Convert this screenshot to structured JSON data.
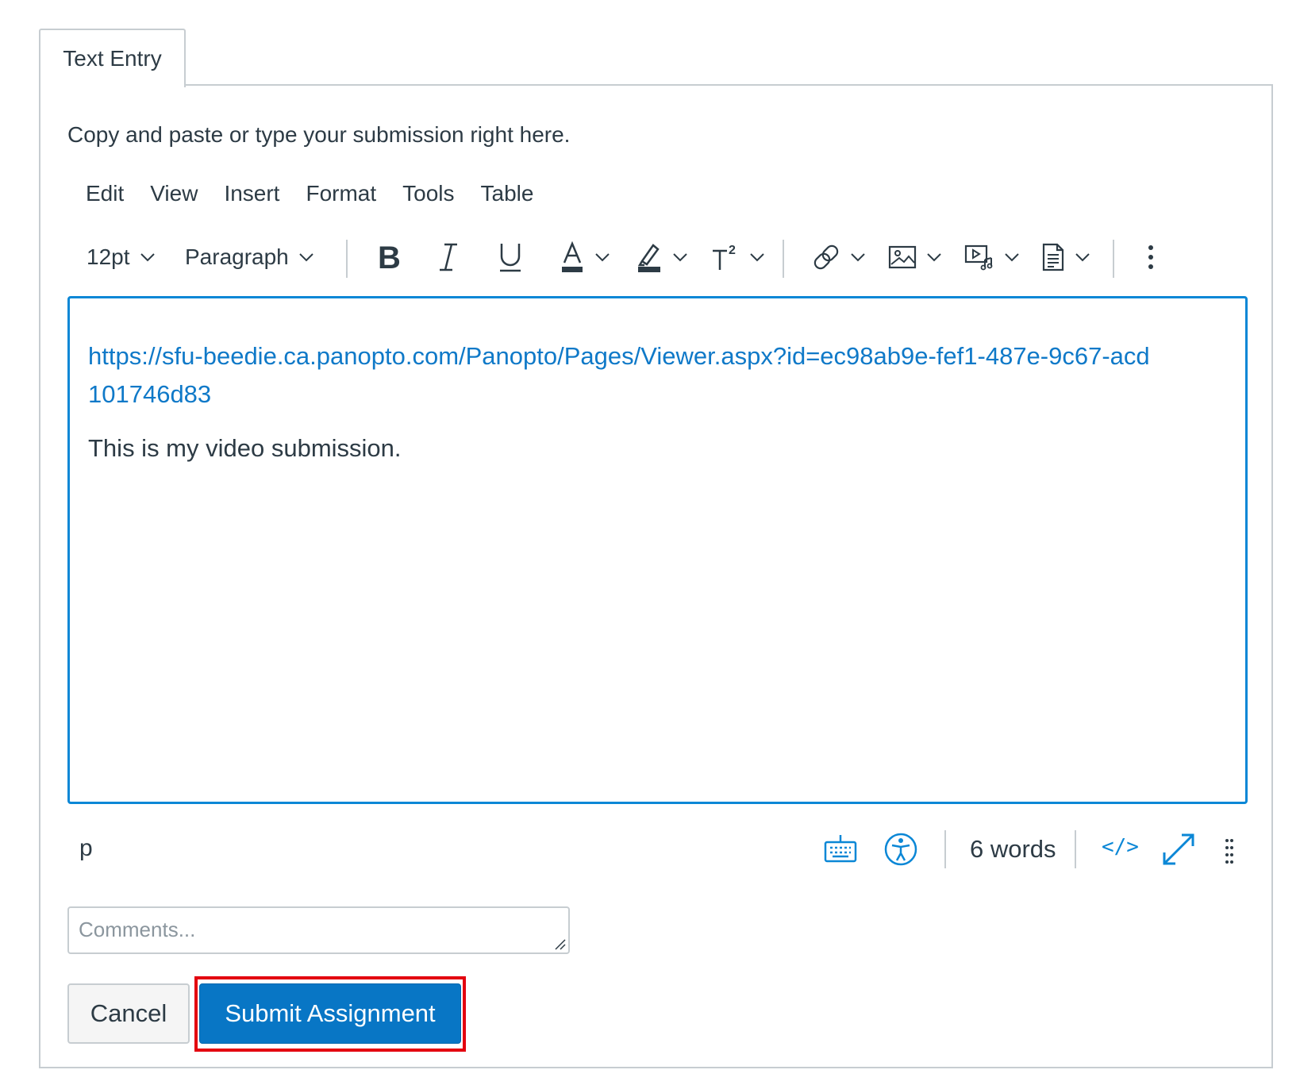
{
  "tab": {
    "label": "Text Entry"
  },
  "instructions": "Copy and paste or type your submission right here.",
  "menubar": {
    "items": [
      "Edit",
      "View",
      "Insert",
      "Format",
      "Tools",
      "Table"
    ]
  },
  "toolbar": {
    "font_size": "12pt",
    "block_format": "Paragraph",
    "icons": [
      "bold-icon",
      "italic-icon",
      "underline-icon",
      "text-color-icon",
      "highlight-color-icon",
      "superscript-icon",
      "link-icon",
      "image-icon",
      "media-icon",
      "document-icon",
      "more-icon"
    ]
  },
  "editor": {
    "link_text": "https://sfu-beedie.ca.panopto.com/Panopto/Pages/Viewer.aspx?id=ec98ab9e-fef1-487e-9c67-acd101746d83",
    "paragraph": "This is my video submission."
  },
  "statusbar": {
    "path": "p",
    "word_count": "6 words",
    "html_toggle": "</>"
  },
  "comments": {
    "placeholder": "Comments..."
  },
  "buttons": {
    "cancel": "Cancel",
    "submit": "Submit Assignment"
  },
  "colors": {
    "accent": "#0876c5",
    "link": "#0f79c8",
    "editor_border": "#0b87d6",
    "highlight": "#e3000f",
    "border": "#c7cdd1",
    "text": "#2d3b45"
  }
}
